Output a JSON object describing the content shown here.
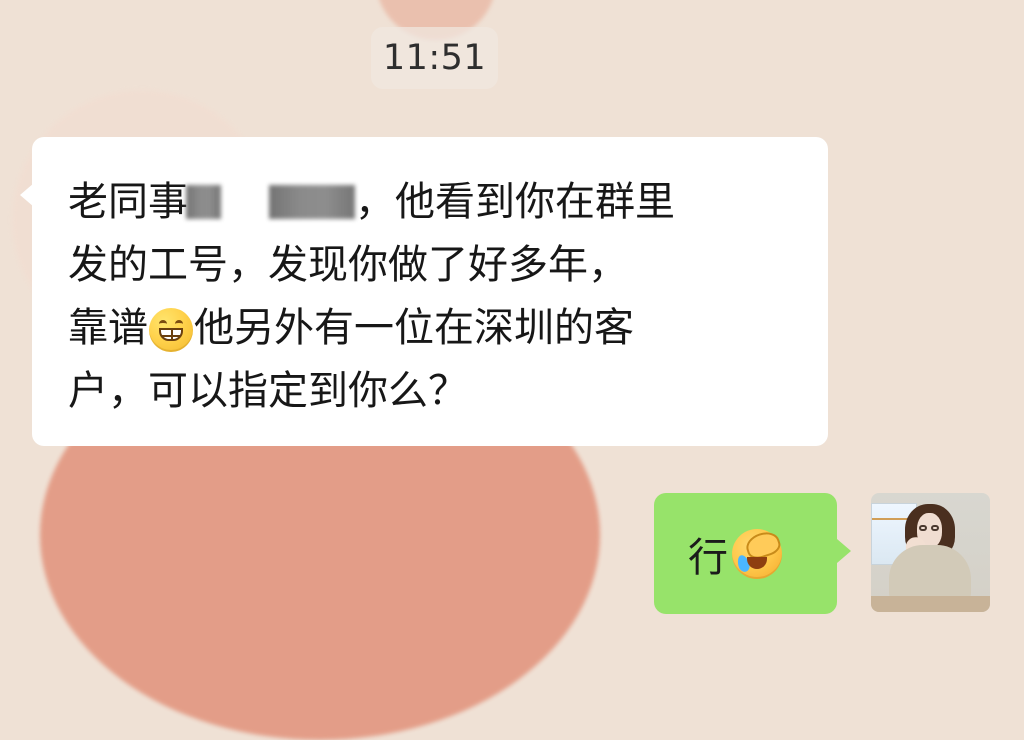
{
  "chat": {
    "timestamp": "11:51",
    "incoming_message": {
      "line_1_prefix": "老同事",
      "line_1_suffix": "，他看到你在群里",
      "line_2": "发的工号，发现你做了好多年，",
      "line_3_prefix": "靠谱",
      "line_3_suffix": "他另外有一位在深圳的客",
      "line_4": "户，可以指定到你么？"
    },
    "outgoing_message": {
      "text": "行"
    }
  },
  "icons": {
    "incoming_emoji": "grinning-face-with-smiling-eyes-icon",
    "outgoing_emoji": "facepalm-laughing-icon",
    "avatar": "user-avatar"
  },
  "colors": {
    "incoming_bubble": "#ffffff",
    "outgoing_bubble": "#97e36a",
    "timestamp_pill": "#f0e8e1",
    "background": "#efe1d5",
    "background_accent": "#e39a84"
  }
}
